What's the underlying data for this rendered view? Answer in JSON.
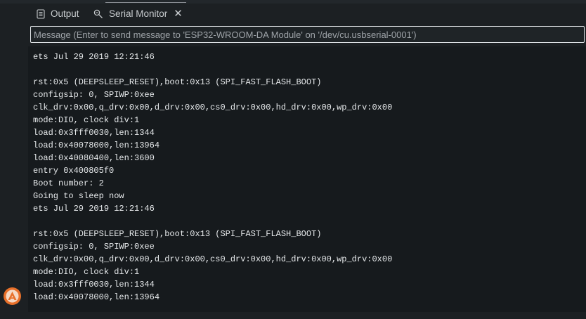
{
  "tabs": [
    {
      "label": "Output",
      "icon": "document-icon",
      "active": false
    },
    {
      "label": "Serial Monitor",
      "icon": "serial-monitor-icon",
      "active": true,
      "close_glyph": "✕"
    }
  ],
  "message_input": {
    "placeholder": "Message (Enter to send message to 'ESP32-WROOM-DA Module' on '/dev/cu.usbserial-0001')",
    "value": ""
  },
  "console": {
    "lines": [
      "ets Jul 29 2019 12:21:46",
      "",
      "rst:0x5 (DEEPSLEEP_RESET),boot:0x13 (SPI_FAST_FLASH_BOOT)",
      "configsip: 0, SPIWP:0xee",
      "clk_drv:0x00,q_drv:0x00,d_drv:0x00,cs0_drv:0x00,hd_drv:0x00,wp_drv:0x00",
      "mode:DIO, clock div:1",
      "load:0x3fff0030,len:1344",
      "load:0x40078000,len:13964",
      "load:0x40080400,len:3600",
      "entry 0x400805f0",
      "Boot number: 2",
      "Going to sleep now",
      "ets Jul 29 2019 12:21:46",
      "",
      "rst:0x5 (DEEPSLEEP_RESET),boot:0x13 (SPI_FAST_FLASH_BOOT)",
      "configsip: 0, SPIWP:0xee",
      "clk_drv:0x00,q_drv:0x00,d_drv:0x00,cs0_drv:0x00,hd_drv:0x00,wp_drv:0x00",
      "mode:DIO, clock div:1",
      "load:0x3fff0030,len:1344",
      "load:0x40078000,len:13964"
    ]
  },
  "avatar": {
    "icon": "avatar-icon",
    "color": "#e8702a"
  },
  "colors": {
    "background": "#1c2023",
    "console_background": "#161a1d",
    "text": "#e6e9eb",
    "tab_text": "#c7cbce",
    "input_border": "#dfe3e6"
  }
}
